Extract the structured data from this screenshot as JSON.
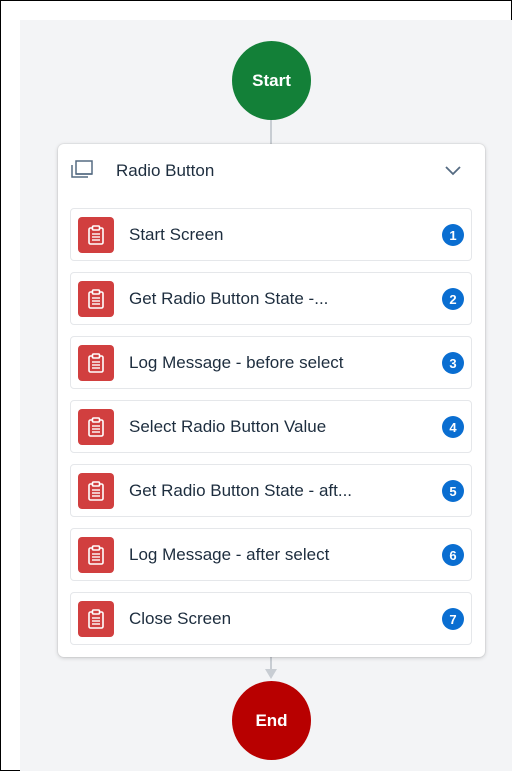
{
  "flow": {
    "start_label": "Start",
    "end_label": "End",
    "group": {
      "title": "Radio Button",
      "steps": [
        {
          "label": "Start Screen",
          "number": "1"
        },
        {
          "label": "Get Radio Button State -...",
          "number": "2"
        },
        {
          "label": "Log Message - before select",
          "number": "3"
        },
        {
          "label": "Select Radio Button Value",
          "number": "4"
        },
        {
          "label": "Get Radio Button State - aft...",
          "number": "5"
        },
        {
          "label": "Log Message - after select",
          "number": "6"
        },
        {
          "label": "Close Screen",
          "number": "7"
        }
      ]
    }
  },
  "icons": {
    "group": "screen-group-icon",
    "collapse": "chevron-down-icon",
    "step": "clipboard-icon"
  },
  "colors": {
    "start": "#138038",
    "end": "#b80000",
    "step_icon": "#d13f3f",
    "badge": "#0a6ed1"
  }
}
